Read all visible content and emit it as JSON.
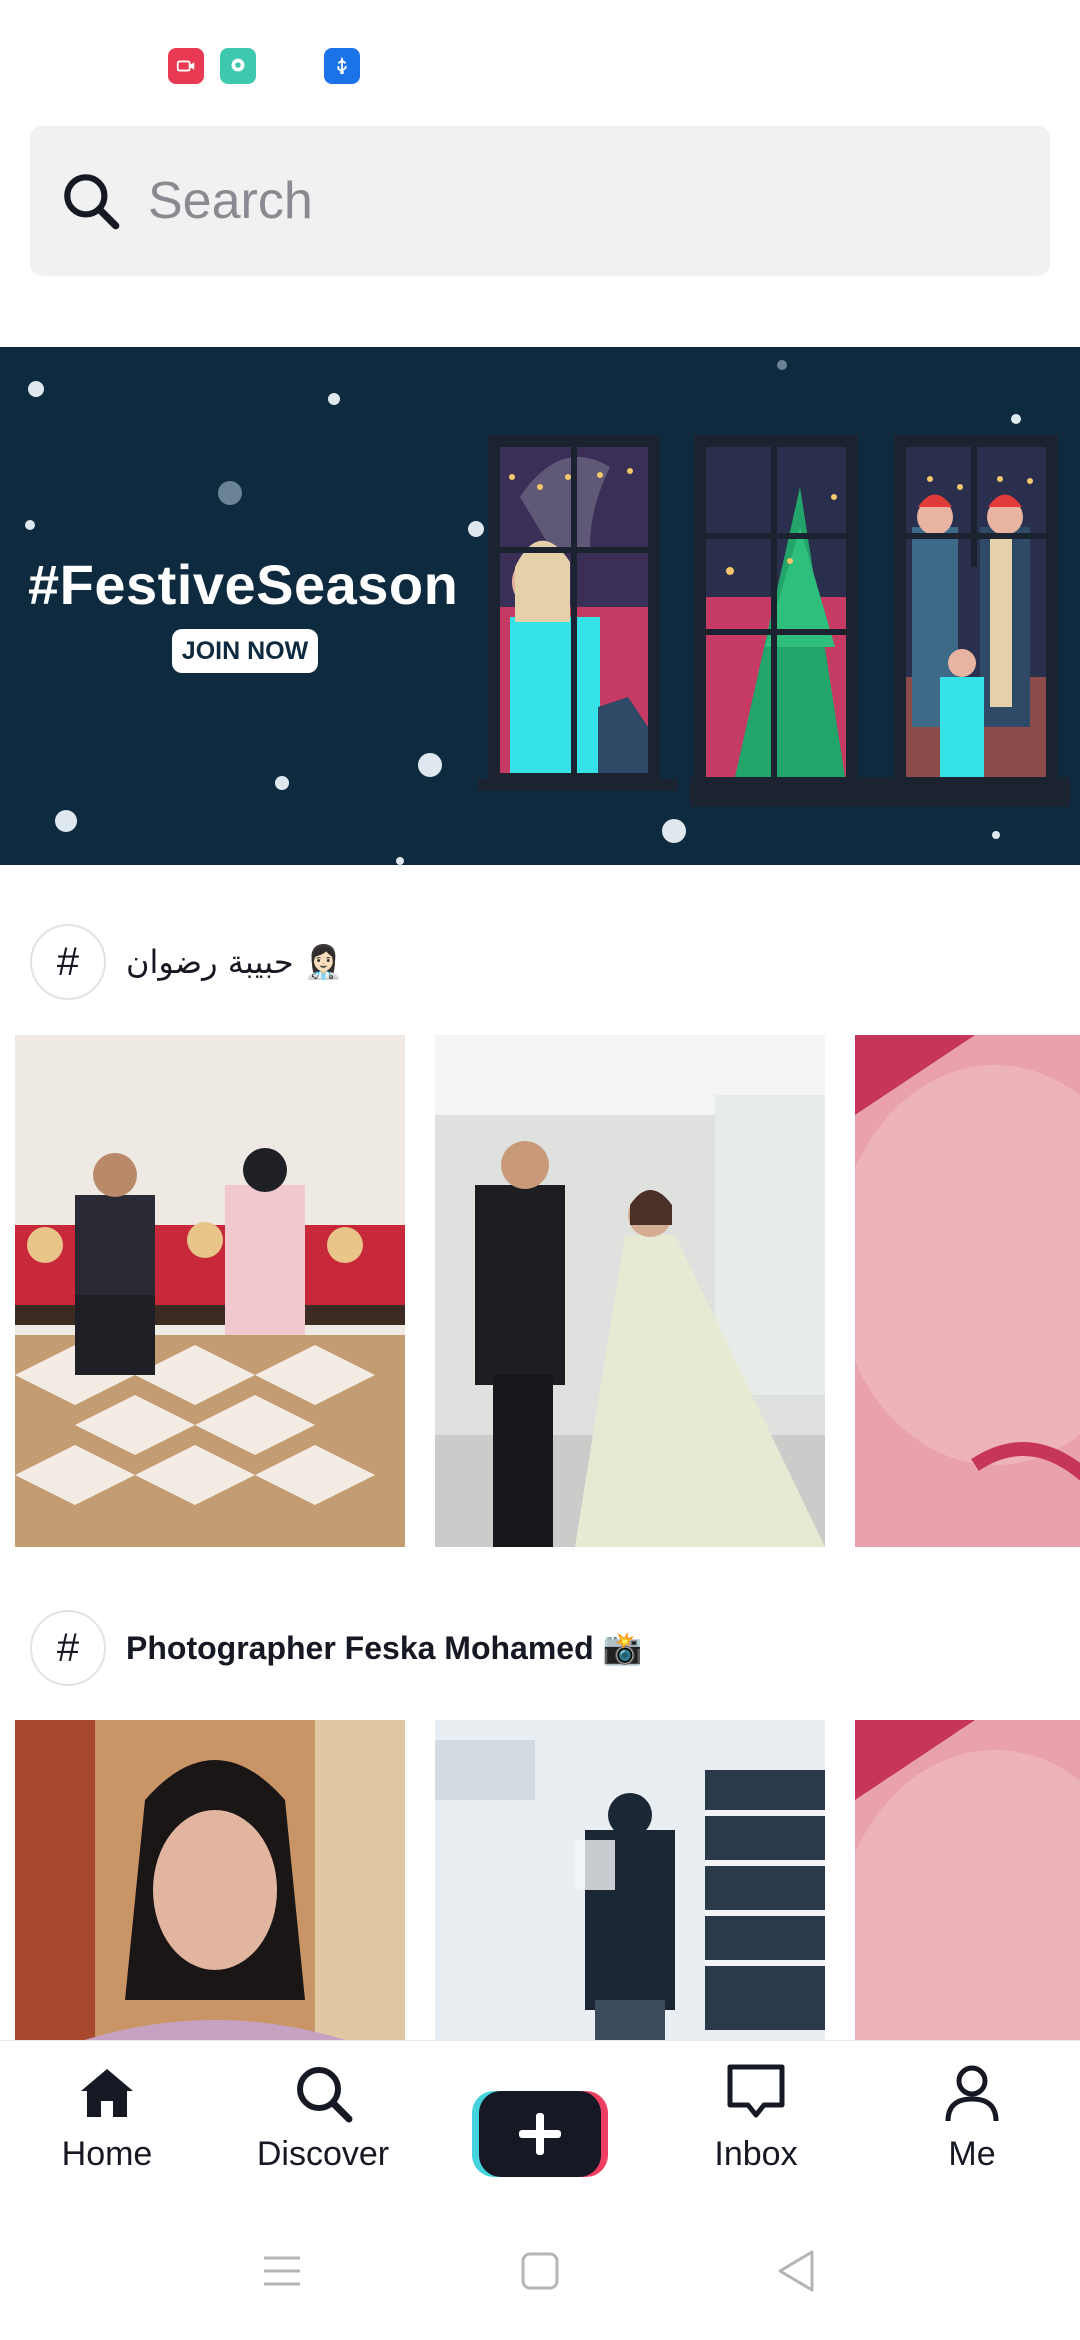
{
  "status_bar": {
    "icons": [
      "screen-record-icon",
      "chat-bubble-icon",
      "usb-icon"
    ],
    "colors": {
      "record": "#e83a52",
      "chat": "#3ec8b0",
      "usb": "#1a73e8"
    }
  },
  "search": {
    "placeholder": "Search",
    "value": ""
  },
  "banner": {
    "title": "#FestiveSeason",
    "cta": "JOIN NOW",
    "background": "#0d2a3f"
  },
  "sections": [
    {
      "hashtag_icon": "#",
      "title": "حبيبة رضوان 👩🏻‍⚕️"
    },
    {
      "hashtag_icon": "#",
      "title": "Photographer Feska Mohamed 📸"
    }
  ],
  "tab_bar": {
    "items": [
      {
        "label": "Home",
        "icon": "home-icon"
      },
      {
        "label": "Discover",
        "icon": "search-icon"
      },
      {
        "label": "",
        "icon": "plus-icon"
      },
      {
        "label": "Inbox",
        "icon": "inbox-icon"
      },
      {
        "label": "Me",
        "icon": "person-icon"
      }
    ],
    "accent_left": "#44d3dd",
    "accent_right": "#ee3f63"
  },
  "system_nav": {
    "icons": [
      "menu-icon",
      "home-square-icon",
      "back-triangle-icon"
    ]
  }
}
